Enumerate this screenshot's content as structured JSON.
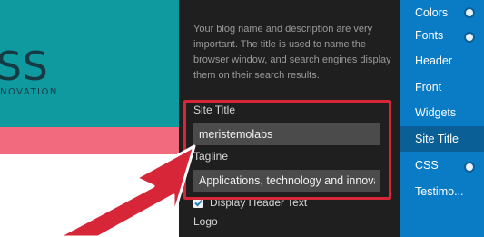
{
  "preview": {
    "logo_fragment": "SS",
    "tagline_fragment": "NOVATION",
    "colors": {
      "header": "#0f9aa0",
      "band": "#f26a7e",
      "highlight": "#d72638"
    }
  },
  "panel": {
    "description": "Your blog name and description are very important. The title is used to name the browser window, and search engines display them on their search results.",
    "site_title_label": "Site Title",
    "site_title_value": "meristemolabs",
    "tagline_label": "Tagline",
    "tagline_value": "Applications, technology and innovat",
    "display_header_text_label": "Display Header Text",
    "display_header_text_checked": true,
    "logo_label": "Logo"
  },
  "sidebar": {
    "items": [
      {
        "label": "Colors",
        "has_toggle": true
      },
      {
        "label": "Fonts",
        "has_toggle": true
      },
      {
        "label": "Header",
        "has_toggle": false
      },
      {
        "label": "Front",
        "has_toggle": false
      },
      {
        "label": "Widgets",
        "has_toggle": false
      },
      {
        "label": "Site Title",
        "has_toggle": false,
        "active": true
      },
      {
        "label": "CSS",
        "has_toggle": true
      },
      {
        "label": "Testimo...",
        "has_toggle": false
      }
    ]
  }
}
